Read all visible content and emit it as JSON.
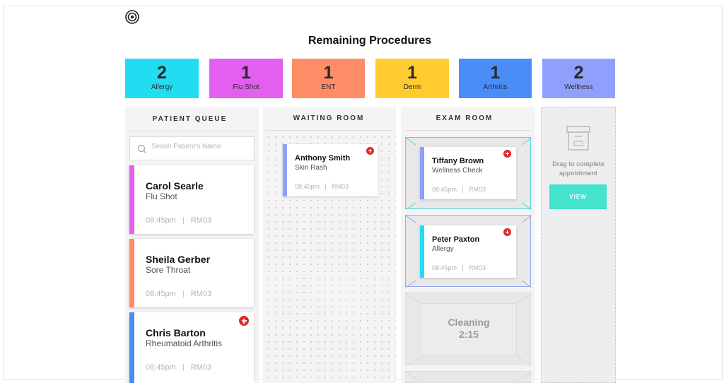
{
  "app": {
    "logo_icon": "concentric-circles-logo"
  },
  "header": {
    "title": "Remaining Procedures"
  },
  "procedures": [
    {
      "count": "2",
      "label": "Allergy",
      "color": "#22ddf2"
    },
    {
      "count": "1",
      "label": "Flu Shot",
      "color": "#e25ff0"
    },
    {
      "count": "1",
      "label": "ENT",
      "color": "#ff8c66"
    },
    {
      "count": "1",
      "label": "Derm",
      "color": "#ffcb2e"
    },
    {
      "count": "1",
      "label": "Arthritis",
      "color": "#4b8df8"
    },
    {
      "count": "2",
      "label": "Wellness",
      "color": "#8f9ffb"
    }
  ],
  "columns": {
    "queue": "PATIENT QUEUE",
    "waiting": "WAITING ROOM",
    "exam": "EXAM ROOM"
  },
  "search": {
    "placeholder": "Seach Patient's Name"
  },
  "queue": [
    {
      "name": "Carol Searle",
      "procedure": "Flu Shot",
      "time": "08:45pm",
      "room": "RM03",
      "color": "#e25ff0",
      "urgent": false
    },
    {
      "name": "Sheila Gerber",
      "procedure": "Sore Throat",
      "time": "08:45pm",
      "room": "RM03",
      "color": "#ff8c66",
      "urgent": false
    },
    {
      "name": "Chris Barton",
      "procedure": "Rheumatoid Arthritis",
      "time": "08:45pm",
      "room": "RM03",
      "color": "#4b8df8",
      "urgent": true
    }
  ],
  "waiting": [
    {
      "name": "Anthony Smith",
      "procedure": "Skin Rash",
      "time": "08:45pm",
      "room": "RM03",
      "color": "#8f9ffb",
      "urgent": true
    }
  ],
  "exam": [
    {
      "name": "Tiffany Brown",
      "procedure": "Wellness Check",
      "time": "08:45pm",
      "room": "RM03",
      "color": "#8f9ffb",
      "urgent": true
    },
    {
      "name": "Peter Paxton",
      "procedure": "Allergy",
      "time": "08:45pm",
      "room": "RM03",
      "color": "#22ddf2",
      "urgent": true
    }
  ],
  "cleaning": {
    "label": "Cleaning",
    "timer": "2:15"
  },
  "complete": {
    "label": "Drag to complete appointment",
    "button": "VIEW",
    "icon": "archive-box-icon",
    "button_color": "#44e3cc"
  }
}
